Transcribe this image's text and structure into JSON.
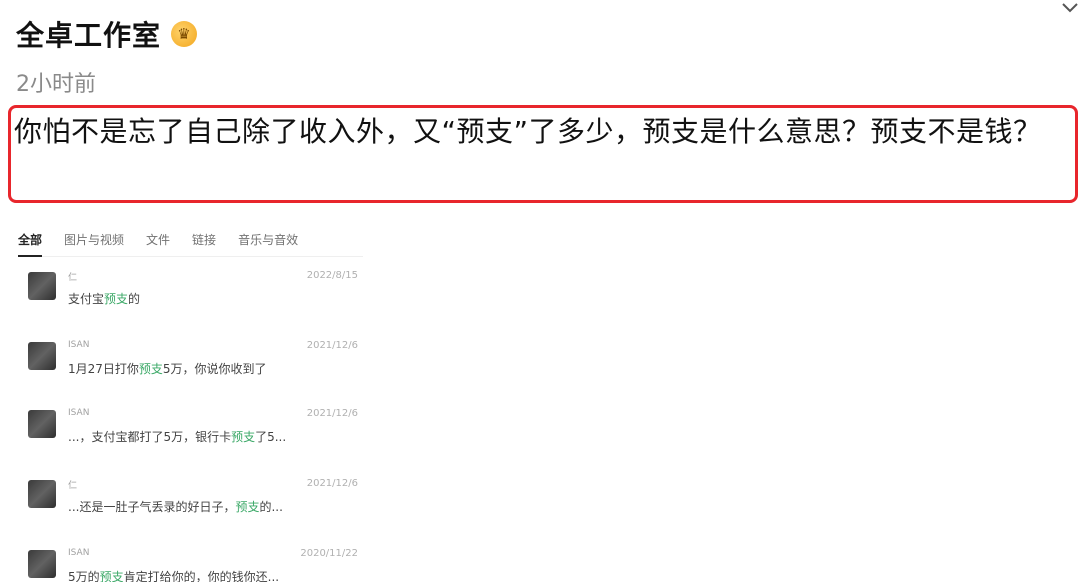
{
  "post": {
    "author": "全卓工作室",
    "badge_icon": "vip-crown-icon",
    "time": "2小时前",
    "text": "你怕不是忘了自己除了收入外，又“预支”了多少，预支是什么意思？预支不是钱？",
    "highlight_color": "#e8262c"
  },
  "embed": {
    "tabs": [
      "全部",
      "图片与视频",
      "文件",
      "链接",
      "音乐与音效"
    ],
    "active_tab": "全部",
    "items": [
      {
        "user": "仁",
        "date": "2022/8/15",
        "pre": "支付宝",
        "hl": "预支",
        "post": "的"
      },
      {
        "user": "ISAN",
        "date": "2021/12/6",
        "pre": "1月27日打你",
        "hl": "预支",
        "post": "5万，你说你收到了"
      },
      {
        "user": "ISAN",
        "date": "2021/12/6",
        "pre": "...，支付宝都打了5万，银行卡",
        "hl": "预支",
        "post": "了5..."
      },
      {
        "user": "仁",
        "date": "2021/12/6",
        "pre": "...还是一肚子气丢录的好日子，",
        "hl": "预支",
        "post": "的..."
      },
      {
        "user": "ISAN",
        "date": "2020/11/22",
        "pre": "5万的",
        "hl": "预支",
        "post": "肯定打给你的，你的钱你还..."
      }
    ],
    "highlight_color": "#2aa15a"
  }
}
